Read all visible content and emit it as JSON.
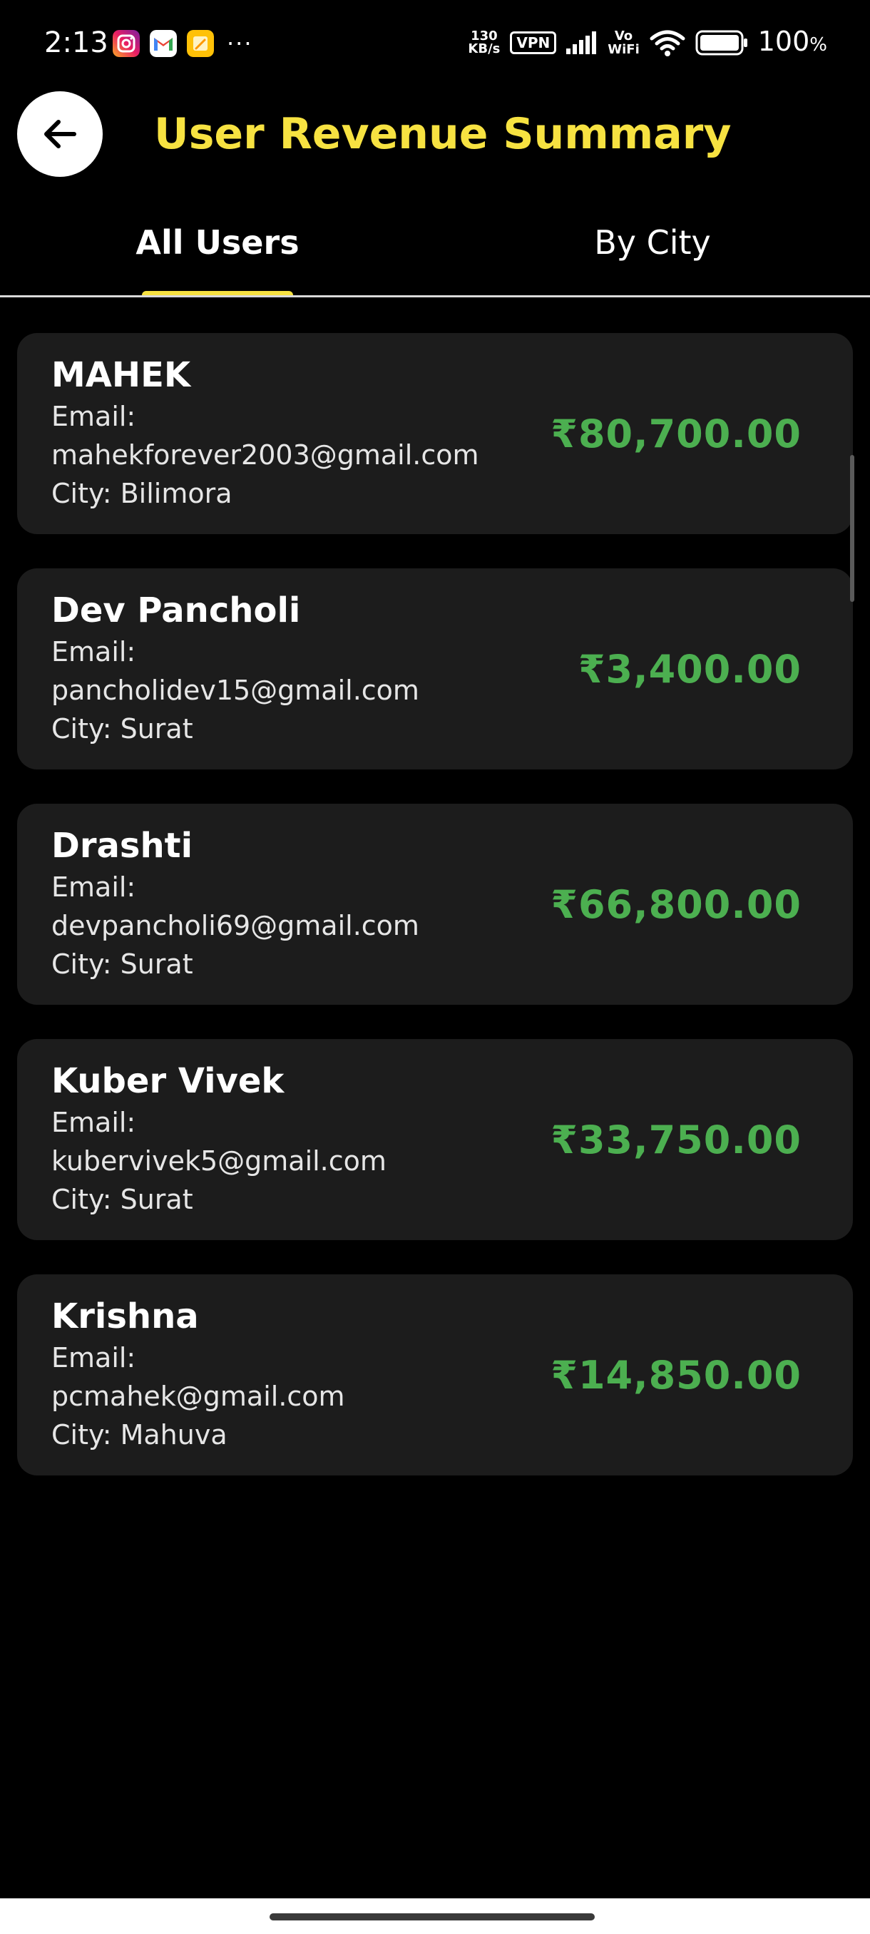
{
  "status_bar": {
    "time": "2:13",
    "more": "···",
    "net_speed_value": "130",
    "net_speed_unit": "KB/s",
    "vpn": "VPN",
    "vo": "Vo",
    "wifi_label": "WiFi",
    "battery_pct": "100",
    "battery_unit": "%"
  },
  "header": {
    "title": "User Revenue Summary"
  },
  "tabs": [
    {
      "label": "All Users",
      "selected": true
    },
    {
      "label": "By City",
      "selected": false
    }
  ],
  "colors": {
    "background": "#000000",
    "title": "#f7e241",
    "card": "#1c1c1c",
    "revenue": "#4caf50",
    "tab_indicator": "#f7e241"
  },
  "users": [
    {
      "name": "MAHEK",
      "email_label": "Email:",
      "email": "mahekforever2003@gmail.com",
      "city_line": "City: Bilimora",
      "revenue": "₹80,700.00"
    },
    {
      "name": "Dev Pancholi",
      "email_label": "Email:",
      "email": "pancholidev15@gmail.com",
      "city_line": "City: Surat",
      "revenue": "₹3,400.00"
    },
    {
      "name": "Drashti",
      "email_label": "Email:",
      "email": "devpancholi69@gmail.com",
      "city_line": "City: Surat",
      "revenue": "₹66,800.00"
    },
    {
      "name": "Kuber Vivek",
      "email_label": "Email:",
      "email": "kubervivek5@gmail.com",
      "city_line": "City: Surat",
      "revenue": "₹33,750.00"
    },
    {
      "name": "Krishna",
      "email_label": "Email:",
      "email": "pcmahek@gmail.com",
      "city_line": "City: Mahuva",
      "revenue": "₹14,850.00"
    }
  ]
}
